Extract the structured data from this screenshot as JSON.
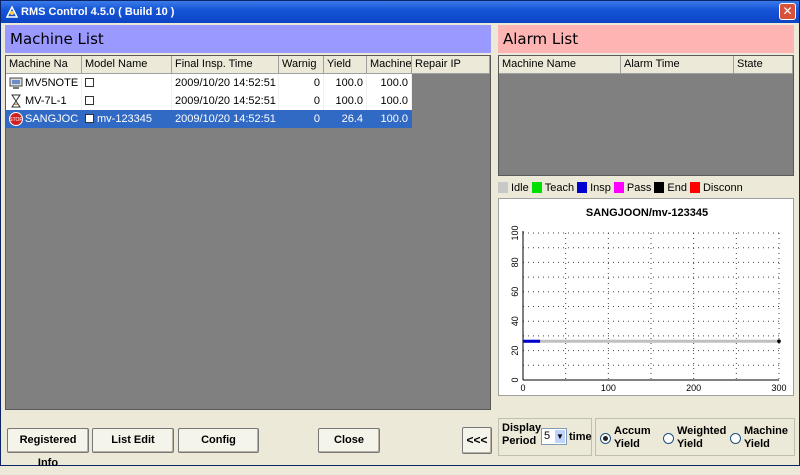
{
  "window": {
    "title": "RMS Control 4.5.0 ( Build 10 )"
  },
  "machine_list": {
    "header": "Machine List",
    "columns": [
      "Machine Na",
      "Model Name",
      "Final Insp. Time",
      "Warnig",
      "Yield",
      "Machine",
      "Repair IP"
    ],
    "rows": [
      {
        "name": "MV5NOTE",
        "model": "",
        "time": "2009/10/20 14:52:51",
        "warning": "0",
        "yield": "100.0",
        "machine": "100.0",
        "repair_ip": "",
        "icon": "computer-icon",
        "selected": false
      },
      {
        "name": "MV-7L-1",
        "model": "",
        "time": "2009/10/20 14:52:51",
        "warning": "0",
        "yield": "100.0",
        "machine": "100.0",
        "repair_ip": "",
        "icon": "hourglass-icon",
        "selected": false
      },
      {
        "name": "SANGJOC",
        "model": "mv-123345",
        "time": "2009/10/20 14:52:51",
        "warning": "0",
        "yield": "26.4",
        "machine": "100.0",
        "repair_ip": "",
        "icon": "stop-sign-icon",
        "selected": true
      }
    ]
  },
  "alarm_list": {
    "header": "Alarm List",
    "columns": [
      "Machine Name",
      "Alarm Time",
      "State"
    ]
  },
  "legend": [
    {
      "label": "Idle",
      "color": "#c8c8c8"
    },
    {
      "label": "Teach",
      "color": "#00e000"
    },
    {
      "label": "Insp",
      "color": "#0000d0"
    },
    {
      "label": "Pass",
      "color": "#ff00ff"
    },
    {
      "label": "End",
      "color": "#000000"
    },
    {
      "label": "Disconn",
      "color": "#ff0000"
    }
  ],
  "chart_data": {
    "type": "line",
    "title": "SANGJOON/mv-123345",
    "xlabel": "",
    "ylabel": "",
    "xlim": [
      0,
      300
    ],
    "ylim": [
      0,
      100
    ],
    "xticks": [
      "0",
      "100",
      "200",
      "300"
    ],
    "yticks": [
      "0",
      "20",
      "40",
      "60",
      "80",
      "100"
    ],
    "grid": true,
    "series": [
      {
        "x": [
          0,
          300
        ],
        "y": [
          26.4,
          26.4
        ],
        "color": "#c0c0c0"
      },
      {
        "x": [
          0,
          20
        ],
        "y": [
          26.4,
          26.4
        ],
        "color": "#0000d0"
      }
    ]
  },
  "buttons": {
    "registered_info": "Registered Info",
    "list_edit": "List Edit",
    "config": "Config",
    "close": "Close",
    "collapse": "<<<"
  },
  "display_period": {
    "label_1": "Display",
    "label_2": "Period",
    "value": "5",
    "unit": "time"
  },
  "yield_options": [
    {
      "line1": "Accum",
      "line2": "Yield",
      "checked": true
    },
    {
      "line1": "Weighted",
      "line2": "Yield",
      "checked": false
    },
    {
      "line1": "Machine",
      "line2": "Yield",
      "checked": false
    }
  ]
}
